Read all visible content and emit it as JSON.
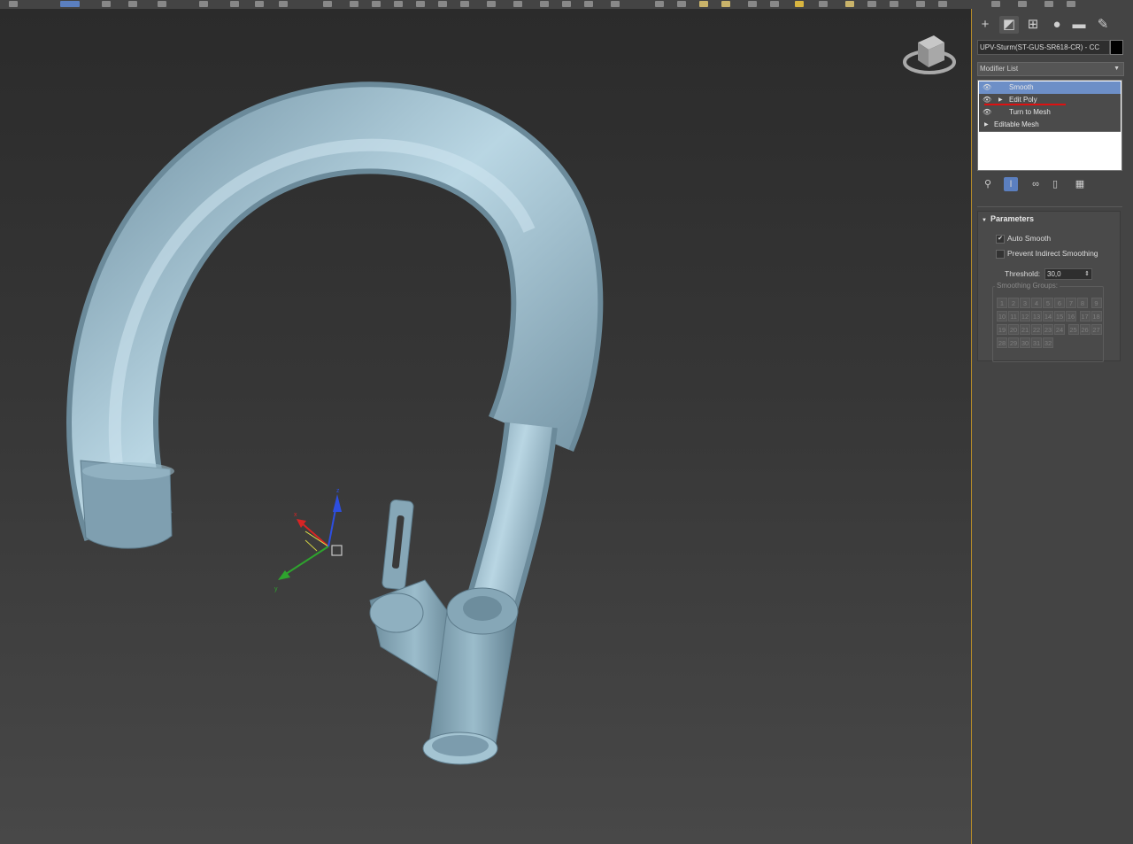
{
  "command_panel": {
    "tabs": [
      {
        "icon": "plus-icon",
        "glyph": "+"
      },
      {
        "icon": "modify-icon",
        "glyph": "◩"
      },
      {
        "icon": "hierarchy-icon",
        "glyph": "⊞"
      },
      {
        "icon": "motion-icon",
        "glyph": "●"
      },
      {
        "icon": "display-icon",
        "glyph": "▬"
      },
      {
        "icon": "utilities-icon",
        "glyph": "✎"
      }
    ],
    "object_name": "UPV-Sturm(ST-GUS-SR618-CR) - CC",
    "object_color": "#000000",
    "modifier_list_label": "Modifier List",
    "modifier_stack": [
      {
        "label": "Smooth",
        "selected": true,
        "expandable": false,
        "eye": true
      },
      {
        "label": "Edit Poly",
        "selected": false,
        "expandable": true,
        "eye": true
      },
      {
        "label": "Turn to Mesh",
        "selected": false,
        "expandable": false,
        "eye": true
      },
      {
        "label": "Editable Mesh",
        "selected": false,
        "expandable": true,
        "eye": false
      }
    ],
    "stack_tools": [
      {
        "icon": "pin-stack-icon",
        "glyph": "⚲"
      },
      {
        "icon": "show-end-result-icon",
        "glyph": "I"
      },
      {
        "icon": "make-unique-icon",
        "glyph": "∞"
      },
      {
        "icon": "remove-modifier-icon",
        "glyph": "▯"
      },
      {
        "icon": "configure-modifier-sets-icon",
        "glyph": "▦"
      }
    ],
    "parameters": {
      "title": "Parameters",
      "auto_smooth_label": "Auto Smooth",
      "auto_smooth_checked": true,
      "prevent_indirect_label": "Prevent Indirect Smoothing",
      "prevent_indirect_checked": false,
      "threshold_label": "Threshold:",
      "threshold_value": "30,0",
      "smoothing_groups_label": "Smoothing Groups:",
      "smoothing_groups": [
        "1",
        "2",
        "3",
        "4",
        "5",
        "6",
        "7",
        "8",
        "9",
        "10",
        "11",
        "12",
        "13",
        "14",
        "15",
        "16",
        "17",
        "18",
        "19",
        "20",
        "21",
        "22",
        "23",
        "24",
        "25",
        "26",
        "27",
        "28",
        "29",
        "30",
        "31",
        "32"
      ]
    }
  },
  "viewport": {
    "gizmo_axes": [
      "x",
      "y",
      "z"
    ],
    "model_color": "#8fb1c1",
    "accent_border": "#b48a2a"
  }
}
